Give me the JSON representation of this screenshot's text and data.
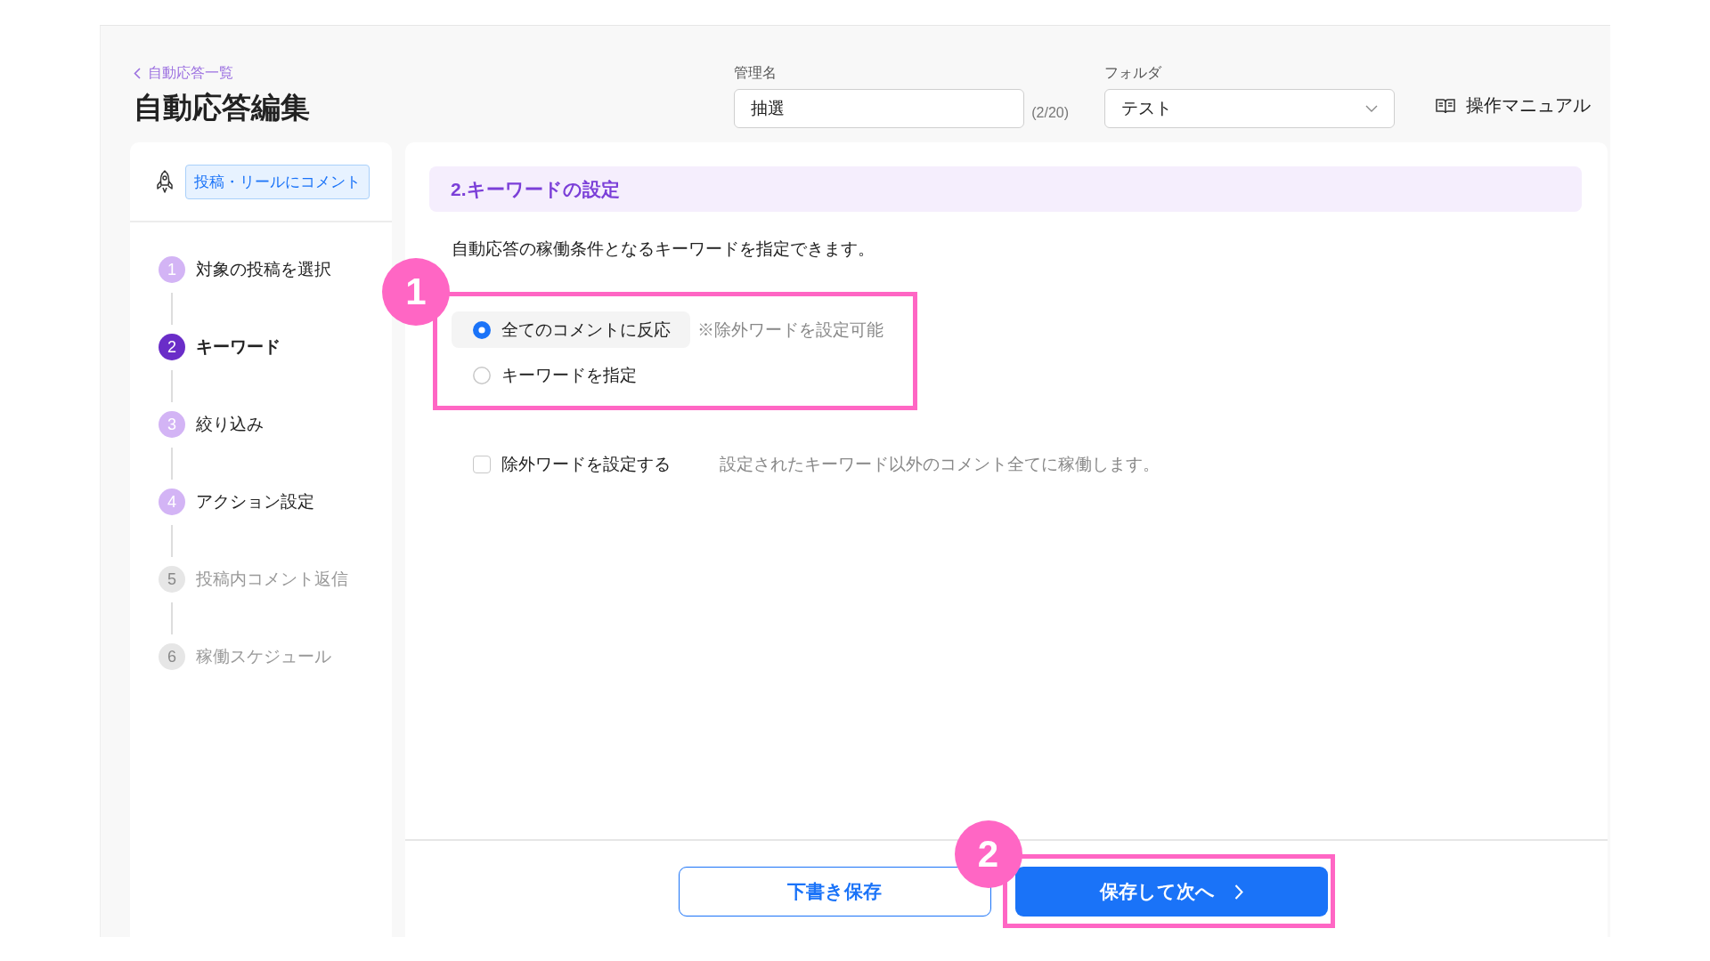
{
  "breadcrumb": {
    "label": "自動応答一覧"
  },
  "title": "自動応答編集",
  "fields": [
    {
      "kind": "text",
      "label": "管理名",
      "value": "抽選",
      "counter": "(2/20)"
    },
    {
      "kind": "select",
      "label": "フォルダ",
      "value": "テスト"
    }
  ],
  "manual_link": "操作マニュアル",
  "sidebar": {
    "trigger_tag": "投稿・リールにコメント",
    "steps": [
      {
        "number": "1",
        "label": "対象の投稿を選択",
        "selected": false,
        "disabled": false
      },
      {
        "number": "2",
        "label": "キーワード",
        "selected": true,
        "disabled": false
      },
      {
        "number": "3",
        "label": "絞り込み",
        "selected": false,
        "disabled": false
      },
      {
        "number": "4",
        "label": "アクション設定",
        "selected": false,
        "disabled": false
      },
      {
        "number": "5",
        "label": "投稿内コメント返信",
        "selected": false,
        "disabled": true
      },
      {
        "number": "6",
        "label": "稼働スケジュール",
        "selected": false,
        "disabled": true
      }
    ]
  },
  "section": {
    "title": "2.キーワードの設定",
    "description": "自動応答の稼働条件となるキーワードを指定できます。",
    "callout": "1",
    "options": [
      {
        "label": "全てのコメントに反応",
        "note": "※除外ワードを設定可能",
        "selected": true
      },
      {
        "label": "キーワードを指定",
        "selected": false
      }
    ],
    "exclude": {
      "label": "除外ワードを設定する",
      "checked": false,
      "note": "設定されたキーワード以外のコメント全てに稼働します。"
    }
  },
  "footer": {
    "buttons": [
      {
        "label": "下書き保存",
        "kind": "secondary"
      },
      {
        "label": "保存して次へ",
        "kind": "primary",
        "callout": "2"
      }
    ]
  }
}
